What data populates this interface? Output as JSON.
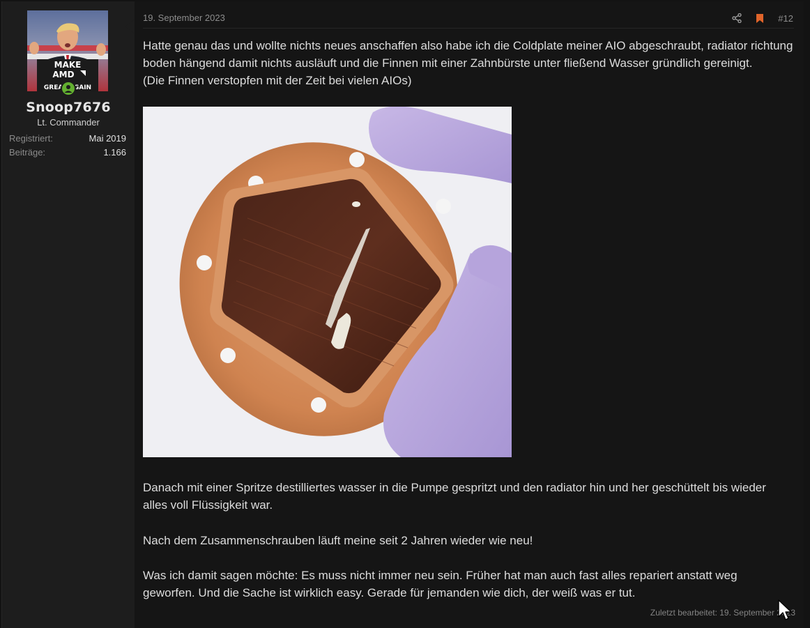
{
  "user": {
    "name": "Snoop7676",
    "title": "Lt. Commander",
    "stats": [
      {
        "label": "Registriert:",
        "value": "Mai 2019"
      },
      {
        "label": "Beiträge:",
        "value": "1.166"
      }
    ],
    "avatar_text": [
      "MAKE",
      "AMD",
      "GREAT AGAIN"
    ],
    "online_icon": "user-online-icon"
  },
  "post": {
    "date": "19. September 2023",
    "number": "#12",
    "share_icon": "share-icon",
    "bookmark_icon": "bookmark-icon",
    "intro_lines": [
      "Hatte genau das und wollte nichts neues anschaffen also habe ich die Coldplate meiner AIO abgeschraubt, radiator richtung boden hängend damit nichts ausläuft und die Finnen mit einer Zahnbürste unter fließend Wasser gründlich gereinigt.",
      "(Die Finnen verstopfen mit der Zeit bei vielen AIOs)"
    ],
    "para_2": "Danach mit einer Spritze destilliertes wasser in die Pumpe gespritzt und den radiator hin und her geschüttelt bis wieder alles voll Flüssigkeit war.",
    "para_3": "Nach dem Zusammenschrauben läuft meine seit 2 Jahren wieder wie neu!",
    "para_4": "Was ich damit sagen möchte: Es muss nicht immer neu sein. Früher hat man auch fast alles repariert anstatt weg geworfen. Und die Sache ist wirklich easy. Gerade für jemanden wie dich, der weiß was er tut.",
    "edited": "Zuletzt bearbeitet: 19. September 2023"
  },
  "colors": {
    "bookmark": "#e0642a",
    "online": "#63b030",
    "text": "#dcdcdc",
    "muted": "#8c8c8c"
  }
}
